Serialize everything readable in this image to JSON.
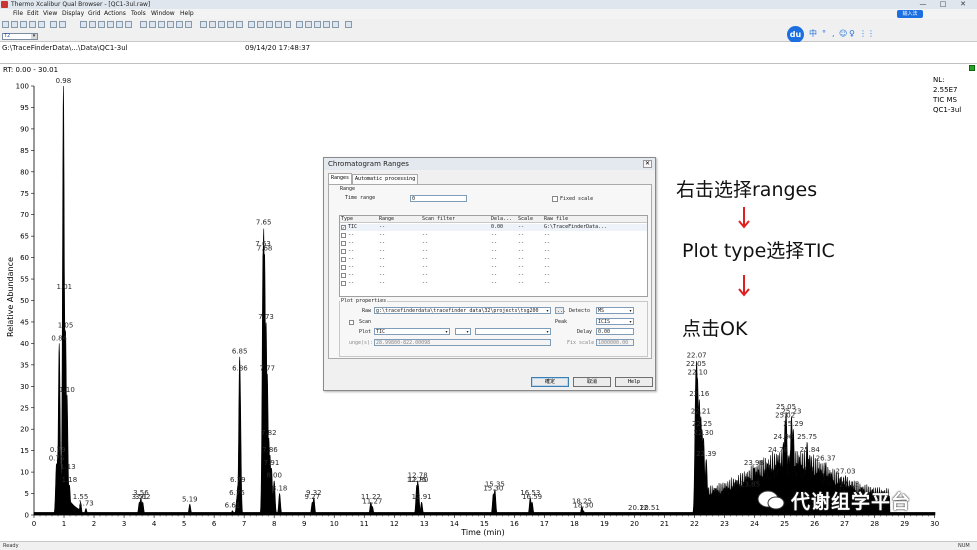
{
  "window": {
    "title": "Thermo Xcalibur Qual Browser - [QC1-3ul.raw]",
    "minimize": "—",
    "maximize": "□",
    "close": "✕"
  },
  "menu": [
    "File",
    "Edit",
    "View",
    "Display",
    "Grid",
    "Actions",
    "Tools",
    "Window",
    "Help"
  ],
  "toolbar2": {
    "combo_value": "T2"
  },
  "ime": {
    "logo": "du",
    "glyphs": [
      "中",
      "°",
      ",",
      "☺",
      "♀",
      "⋮⋮"
    ],
    "top_badge": "输入法"
  },
  "file_bar": {
    "path": "G:\\TraceFinderData\\...\\Data\\QC1-3ul",
    "datetime": "09/14/20 17:48:37"
  },
  "plot": {
    "rt_range": "RT: 0.00 - 30.01",
    "info": [
      "NL:",
      "2.55E7",
      "TIC  MS",
      "QC1-3ul"
    ]
  },
  "chart_data": {
    "type": "line",
    "title": "",
    "xlabel": "Time (min)",
    "ylabel": "Relative Abundance",
    "xlim": [
      0,
      30.01
    ],
    "ylim": [
      0,
      100
    ],
    "x_ticks": [
      0,
      1,
      2,
      3,
      4,
      5,
      6,
      7,
      8,
      9,
      10,
      11,
      12,
      13,
      14,
      15,
      16,
      17,
      18,
      19,
      20,
      21,
      22,
      23,
      24,
      25,
      26,
      27,
      28,
      29,
      30
    ],
    "y_ticks": [
      0,
      5,
      10,
      15,
      20,
      25,
      30,
      35,
      40,
      45,
      50,
      55,
      60,
      65,
      70,
      75,
      80,
      85,
      90,
      95,
      100
    ],
    "grid": false,
    "legend": "none",
    "series_color": "#000000",
    "label_color": "#2a2a2a",
    "peaks": [
      {
        "rt": 0.75,
        "y": 12,
        "label": "0.75"
      },
      {
        "rt": 0.79,
        "y": 14,
        "label": "0.79"
      },
      {
        "rt": 0.84,
        "y": 40,
        "label": "0.84"
      },
      {
        "rt": 0.98,
        "y": 100,
        "label": "0.98"
      },
      {
        "rt": 1.01,
        "y": 52,
        "label": "1.01"
      },
      {
        "rt": 1.05,
        "y": 43,
        "label": "1.05"
      },
      {
        "rt": 1.1,
        "y": 28,
        "label": "1.10"
      },
      {
        "rt": 1.13,
        "y": 10,
        "label": "1.13"
      },
      {
        "rt": 1.18,
        "y": 7,
        "label": "1.18"
      },
      {
        "rt": 1.55,
        "y": 3,
        "label": "1.55"
      },
      {
        "rt": 1.73,
        "y": 1.5,
        "label": "1.73"
      },
      {
        "rt": 3.51,
        "y": 3,
        "label": "3.51"
      },
      {
        "rt": 3.56,
        "y": 4,
        "label": "3.56"
      },
      {
        "rt": 3.62,
        "y": 3,
        "label": "3.62"
      },
      {
        "rt": 5.19,
        "y": 2.5,
        "label": "5.19"
      },
      {
        "rt": 6.61,
        "y": 1,
        "label": "6.61"
      },
      {
        "rt": 6.76,
        "y": 4,
        "label": "6.76"
      },
      {
        "rt": 6.79,
        "y": 7,
        "label": "6.79"
      },
      {
        "rt": 6.85,
        "y": 37,
        "label": "6.85"
      },
      {
        "rt": 6.86,
        "y": 33,
        "label": "6.86"
      },
      {
        "rt": 7.63,
        "y": 62,
        "label": "7.63"
      },
      {
        "rt": 7.65,
        "y": 67,
        "label": "7.65"
      },
      {
        "rt": 7.68,
        "y": 61,
        "label": "7.68"
      },
      {
        "rt": 7.73,
        "y": 45,
        "label": "7.73"
      },
      {
        "rt": 7.77,
        "y": 33,
        "label": "7.77"
      },
      {
        "rt": 7.82,
        "y": 18,
        "label": "7.82"
      },
      {
        "rt": 7.86,
        "y": 14,
        "label": "7.86"
      },
      {
        "rt": 7.91,
        "y": 11,
        "label": "7.91"
      },
      {
        "rt": 8.0,
        "y": 8,
        "label": "8.00"
      },
      {
        "rt": 8.18,
        "y": 5,
        "label": "8.18"
      },
      {
        "rt": 9.32,
        "y": 4,
        "label": "9.32"
      },
      {
        "rt": 9.27,
        "y": 3,
        "label": "9.27"
      },
      {
        "rt": 11.22,
        "y": 3,
        "label": "11.22"
      },
      {
        "rt": 11.27,
        "y": 2,
        "label": "11.27"
      },
      {
        "rt": 12.75,
        "y": 7,
        "label": "12.75"
      },
      {
        "rt": 12.78,
        "y": 8,
        "label": "12.78"
      },
      {
        "rt": 12.8,
        "y": 7,
        "label": "12.80"
      },
      {
        "rt": 12.91,
        "y": 3,
        "label": "12.91"
      },
      {
        "rt": 15.3,
        "y": 5,
        "label": "15.30"
      },
      {
        "rt": 15.35,
        "y": 6,
        "label": "15.35"
      },
      {
        "rt": 16.53,
        "y": 4,
        "label": "16.53"
      },
      {
        "rt": 16.59,
        "y": 3,
        "label": "16.59"
      },
      {
        "rt": 18.25,
        "y": 2,
        "label": "18.25"
      },
      {
        "rt": 18.3,
        "y": 1,
        "label": "18.30"
      },
      {
        "rt": 20.12,
        "y": 0.5,
        "label": "20.12"
      },
      {
        "rt": 20.51,
        "y": 0.5,
        "label": "20.51"
      },
      {
        "rt": 22.05,
        "y": 34,
        "label": "22.05"
      },
      {
        "rt": 22.07,
        "y": 36,
        "label": "22.07"
      },
      {
        "rt": 22.1,
        "y": 32,
        "label": "22.10"
      },
      {
        "rt": 22.16,
        "y": 27,
        "label": "22.16"
      },
      {
        "rt": 22.21,
        "y": 23,
        "label": "22.21"
      },
      {
        "rt": 22.25,
        "y": 20,
        "label": "22.25"
      },
      {
        "rt": 22.3,
        "y": 18,
        "label": "22.30"
      },
      {
        "rt": 22.39,
        "y": 13,
        "label": "22.39"
      },
      {
        "rt": 23.85,
        "y": 6,
        "label": "23.85"
      },
      {
        "rt": 23.98,
        "y": 11,
        "label": "23.98"
      },
      {
        "rt": 24.78,
        "y": 14,
        "label": "24.78"
      },
      {
        "rt": 24.96,
        "y": 17,
        "label": "24.96"
      },
      {
        "rt": 25.02,
        "y": 22,
        "label": "25.02"
      },
      {
        "rt": 25.05,
        "y": 24,
        "label": "25.05"
      },
      {
        "rt": 25.23,
        "y": 23,
        "label": "25.23"
      },
      {
        "rt": 25.29,
        "y": 20,
        "label": "25.29"
      },
      {
        "rt": 25.75,
        "y": 17,
        "label": "25.75"
      },
      {
        "rt": 25.84,
        "y": 14,
        "label": "25.84"
      },
      {
        "rt": 26.37,
        "y": 12,
        "label": "26.37"
      },
      {
        "rt": 27.03,
        "y": 9,
        "label": "27.03"
      },
      {
        "rt": 27.15,
        "y": 6,
        "label": "27.15"
      }
    ]
  },
  "dialog": {
    "title": "Chromatogram Ranges",
    "close": "✕",
    "tabs": [
      "Ranges",
      "Automatic processing"
    ],
    "range": {
      "group_label": "Range",
      "time_label": "Time range",
      "time_value": "0",
      "fixed_scale": "Fixed scale"
    },
    "grid_headers": [
      "Type",
      "Range",
      "Scan filter",
      "Dela...",
      "Scale",
      "Raw file"
    ],
    "grid_rows": [
      {
        "type": "TIC",
        "range": "--",
        "filter": "",
        "delay": "0.00",
        "scale": "--",
        "raw": "G:\\TraceFinderData..."
      },
      {
        "type": "--",
        "range": "--",
        "filter": "--",
        "delay": "--",
        "scale": "--",
        "raw": "--"
      },
      {
        "type": "--",
        "range": "--",
        "filter": "--",
        "delay": "--",
        "scale": "--",
        "raw": "--"
      },
      {
        "type": "--",
        "range": "--",
        "filter": "--",
        "delay": "--",
        "scale": "--",
        "raw": "--"
      },
      {
        "type": "--",
        "range": "--",
        "filter": "--",
        "delay": "--",
        "scale": "--",
        "raw": "--"
      },
      {
        "type": "--",
        "range": "--",
        "filter": "--",
        "delay": "--",
        "scale": "--",
        "raw": "--"
      },
      {
        "type": "--",
        "range": "--",
        "filter": "--",
        "delay": "--",
        "scale": "--",
        "raw": "--"
      },
      {
        "type": "--",
        "range": "--",
        "filter": "--",
        "delay": "--",
        "scale": "--",
        "raw": "--"
      }
    ],
    "plot_props": {
      "group_label": "Plot properties",
      "raw_label": "Raw",
      "raw_value": "g:\\tracefinderdata\\tracefinder data\\32\\projects\\tsg200",
      "browse": "...",
      "detector_label": "Detecto",
      "detector_value": "MS",
      "scan_label": "Scan",
      "peak_label": "Peak",
      "peak_value": "ICIS",
      "plot_label": "Plot",
      "plot_value": "TIC",
      "delay_label": "Delay",
      "delay_value": "0.00",
      "range_label": "unge(s):",
      "range_value": "28.99800-822.00098",
      "fix_scale_label": "Fix scale",
      "fix_scale_value": "1000000.00"
    },
    "buttons": [
      "確定",
      "取消",
      "Help"
    ]
  },
  "annotations": {
    "line1": "右击选择ranges",
    "line2": "Plot type选择TIC",
    "line3": "点击OK",
    "arrow_color": "#e02020"
  },
  "watermark": {
    "text": "代谢组学平台"
  },
  "status": {
    "left": "Ready",
    "right": "NUM"
  }
}
